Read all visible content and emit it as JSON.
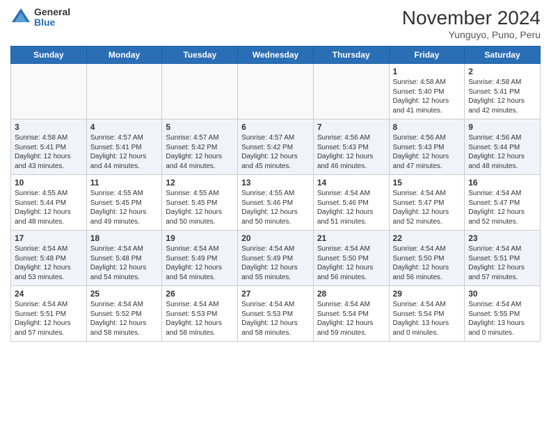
{
  "header": {
    "logo_general": "General",
    "logo_blue": "Blue",
    "month_title": "November 2024",
    "location": "Yunguyo, Puno, Peru"
  },
  "days_of_week": [
    "Sunday",
    "Monday",
    "Tuesday",
    "Wednesday",
    "Thursday",
    "Friday",
    "Saturday"
  ],
  "weeks": [
    [
      {
        "day": "",
        "info": ""
      },
      {
        "day": "",
        "info": ""
      },
      {
        "day": "",
        "info": ""
      },
      {
        "day": "",
        "info": ""
      },
      {
        "day": "",
        "info": ""
      },
      {
        "day": "1",
        "info": "Sunrise: 4:58 AM\nSunset: 5:40 PM\nDaylight: 12 hours and 41 minutes."
      },
      {
        "day": "2",
        "info": "Sunrise: 4:58 AM\nSunset: 5:41 PM\nDaylight: 12 hours and 42 minutes."
      }
    ],
    [
      {
        "day": "3",
        "info": "Sunrise: 4:58 AM\nSunset: 5:41 PM\nDaylight: 12 hours and 43 minutes."
      },
      {
        "day": "4",
        "info": "Sunrise: 4:57 AM\nSunset: 5:41 PM\nDaylight: 12 hours and 44 minutes."
      },
      {
        "day": "5",
        "info": "Sunrise: 4:57 AM\nSunset: 5:42 PM\nDaylight: 12 hours and 44 minutes."
      },
      {
        "day": "6",
        "info": "Sunrise: 4:57 AM\nSunset: 5:42 PM\nDaylight: 12 hours and 45 minutes."
      },
      {
        "day": "7",
        "info": "Sunrise: 4:56 AM\nSunset: 5:43 PM\nDaylight: 12 hours and 46 minutes."
      },
      {
        "day": "8",
        "info": "Sunrise: 4:56 AM\nSunset: 5:43 PM\nDaylight: 12 hours and 47 minutes."
      },
      {
        "day": "9",
        "info": "Sunrise: 4:56 AM\nSunset: 5:44 PM\nDaylight: 12 hours and 48 minutes."
      }
    ],
    [
      {
        "day": "10",
        "info": "Sunrise: 4:55 AM\nSunset: 5:44 PM\nDaylight: 12 hours and 48 minutes."
      },
      {
        "day": "11",
        "info": "Sunrise: 4:55 AM\nSunset: 5:45 PM\nDaylight: 12 hours and 49 minutes."
      },
      {
        "day": "12",
        "info": "Sunrise: 4:55 AM\nSunset: 5:45 PM\nDaylight: 12 hours and 50 minutes."
      },
      {
        "day": "13",
        "info": "Sunrise: 4:55 AM\nSunset: 5:46 PM\nDaylight: 12 hours and 50 minutes."
      },
      {
        "day": "14",
        "info": "Sunrise: 4:54 AM\nSunset: 5:46 PM\nDaylight: 12 hours and 51 minutes."
      },
      {
        "day": "15",
        "info": "Sunrise: 4:54 AM\nSunset: 5:47 PM\nDaylight: 12 hours and 52 minutes."
      },
      {
        "day": "16",
        "info": "Sunrise: 4:54 AM\nSunset: 5:47 PM\nDaylight: 12 hours and 52 minutes."
      }
    ],
    [
      {
        "day": "17",
        "info": "Sunrise: 4:54 AM\nSunset: 5:48 PM\nDaylight: 12 hours and 53 minutes."
      },
      {
        "day": "18",
        "info": "Sunrise: 4:54 AM\nSunset: 5:48 PM\nDaylight: 12 hours and 54 minutes."
      },
      {
        "day": "19",
        "info": "Sunrise: 4:54 AM\nSunset: 5:49 PM\nDaylight: 12 hours and 54 minutes."
      },
      {
        "day": "20",
        "info": "Sunrise: 4:54 AM\nSunset: 5:49 PM\nDaylight: 12 hours and 55 minutes."
      },
      {
        "day": "21",
        "info": "Sunrise: 4:54 AM\nSunset: 5:50 PM\nDaylight: 12 hours and 56 minutes."
      },
      {
        "day": "22",
        "info": "Sunrise: 4:54 AM\nSunset: 5:50 PM\nDaylight: 12 hours and 56 minutes."
      },
      {
        "day": "23",
        "info": "Sunrise: 4:54 AM\nSunset: 5:51 PM\nDaylight: 12 hours and 57 minutes."
      }
    ],
    [
      {
        "day": "24",
        "info": "Sunrise: 4:54 AM\nSunset: 5:51 PM\nDaylight: 12 hours and 57 minutes."
      },
      {
        "day": "25",
        "info": "Sunrise: 4:54 AM\nSunset: 5:52 PM\nDaylight: 12 hours and 58 minutes."
      },
      {
        "day": "26",
        "info": "Sunrise: 4:54 AM\nSunset: 5:53 PM\nDaylight: 12 hours and 58 minutes."
      },
      {
        "day": "27",
        "info": "Sunrise: 4:54 AM\nSunset: 5:53 PM\nDaylight: 12 hours and 58 minutes."
      },
      {
        "day": "28",
        "info": "Sunrise: 4:54 AM\nSunset: 5:54 PM\nDaylight: 12 hours and 59 minutes."
      },
      {
        "day": "29",
        "info": "Sunrise: 4:54 AM\nSunset: 5:54 PM\nDaylight: 13 hours and 0 minutes."
      },
      {
        "day": "30",
        "info": "Sunrise: 4:54 AM\nSunset: 5:55 PM\nDaylight: 13 hours and 0 minutes."
      }
    ]
  ]
}
